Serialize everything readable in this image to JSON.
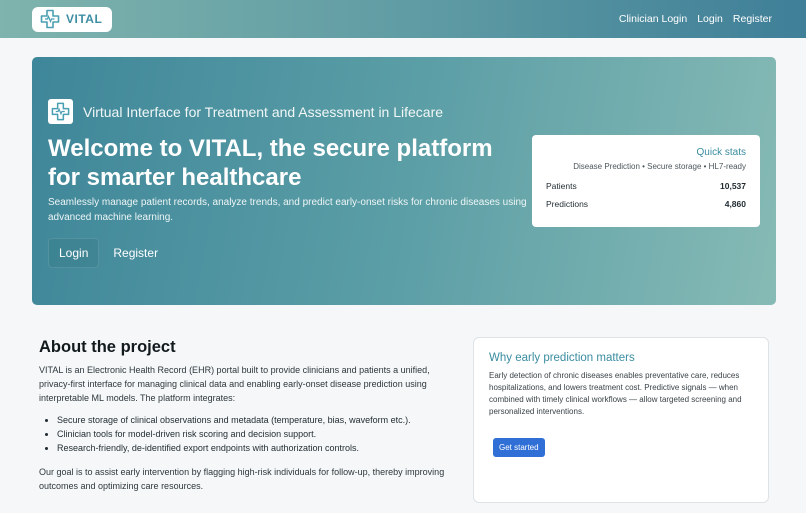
{
  "navbar": {
    "brand": "VITAL",
    "links": [
      "Clinician Login",
      "Login",
      "Register"
    ]
  },
  "hero": {
    "subtitle": "Virtual Interface for Treatment and Assessment in Lifecare",
    "title": "Welcome to VITAL, the secure platform for smarter healthcare",
    "description": "Seamlessly manage patient records, analyze trends, and predict early-onset risks for chronic diseases using advanced machine learning.",
    "login_label": "Login",
    "register_label": "Register"
  },
  "stats": {
    "title": "Quick stats",
    "tagline": "Disease Prediction • Secure storage • HL7-ready",
    "rows": [
      {
        "label": "Patients",
        "value": "10,537"
      },
      {
        "label": "Predictions",
        "value": "4,860"
      }
    ]
  },
  "about": {
    "heading": "About the project",
    "intro": "VITAL is an Electronic Health Record (EHR) portal built to provide clinicians and patients a unified, privacy-first interface for managing clinical data and enabling early-onset disease prediction using interpretable ML models. The platform integrates:",
    "bullets": [
      "Secure storage of clinical observations and metadata (temperature, bias, waveform etc.).",
      "Clinician tools for model-driven risk scoring and decision support.",
      "Research-friendly, de-identified export endpoints with authorization controls."
    ],
    "goal": "Our goal is to assist early intervention by flagging high-risk individuals for follow-up, thereby improving outcomes and optimizing care resources."
  },
  "why": {
    "heading": "Why early prediction matters",
    "body": "Early detection of chronic diseases enables preventative care, reduces hospitalizations, and lowers treatment cost. Predictive signals — when combined with timely clinical workflows — allow targeted screening and personalized interventions.",
    "cta": "Get started"
  },
  "colors": {
    "accent": "#3a8ca0",
    "primary_button": "#2f6fd6"
  }
}
